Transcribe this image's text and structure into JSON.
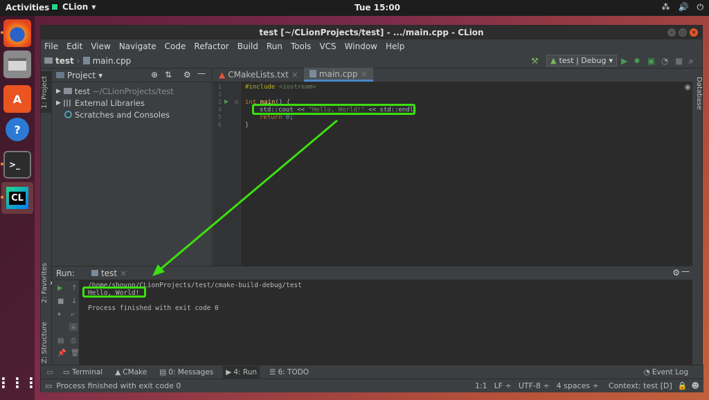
{
  "topbar": {
    "activities": "Activities",
    "app_name": "CLion",
    "clock": "Tue 15:00",
    "tray": [
      "⁂",
      "🔊",
      "⏻"
    ]
  },
  "window": {
    "title": "test [~/CLionProjects/test] - .../main.cpp - CLion"
  },
  "menu": [
    "File",
    "Edit",
    "View",
    "Navigate",
    "Code",
    "Refactor",
    "Build",
    "Run",
    "Tools",
    "VCS",
    "Window",
    "Help"
  ],
  "nav": {
    "crumb_project": "test",
    "crumb_file": "main.cpp",
    "run_config": "test | Debug"
  },
  "project": {
    "header": "Project",
    "items": [
      {
        "label": "test",
        "detail": "~/CLionProjects/test"
      },
      {
        "label": "External Libraries",
        "detail": ""
      },
      {
        "label": "Scratches and Consoles",
        "detail": ""
      }
    ]
  },
  "editor": {
    "tabs": [
      {
        "label": "CMakeLists.txt"
      },
      {
        "label": "main.cpp"
      }
    ],
    "line_numbers": [
      "1",
      "2",
      "3",
      "4",
      "5",
      "6"
    ],
    "lines": {
      "l1_directive": "#include",
      "l1_header": " <iostream>",
      "l3_kw": "int",
      "l3_fn": " main",
      "l3_rest": "() {",
      "l4_a": "std::cout << ",
      "l4_str": "\"Hello, World!\"",
      "l4_b": " << std::endl;",
      "l5_kw": "return",
      "l5_num": " 0",
      "l5_semi": ";",
      "l6": "}"
    }
  },
  "run": {
    "label": "Run:",
    "tab": "test",
    "output": [
      "/home/shovon/CLionProjects/test/cmake-build-debug/test",
      "Hello, World!",
      "",
      "Process finished with exit code 0"
    ]
  },
  "side_tabs": {
    "project": "1: Project",
    "favorites": "2: Favorites",
    "structure": "Z: Structure",
    "database": "Database"
  },
  "tool_tabs": [
    {
      "label": "Terminal"
    },
    {
      "label": "CMake"
    },
    {
      "label": "0: Messages"
    },
    {
      "label": "4: Run"
    },
    {
      "label": "6: TODO"
    }
  ],
  "event_log": "Event Log",
  "status": {
    "message": "Process finished with exit code 0",
    "position": "1:1",
    "line_sep": "LF ÷",
    "encoding": "UTF-8 ÷",
    "indent": "4 spaces ÷",
    "context": "Context: test [D]"
  },
  "colors": {
    "highlight": "#3ce00e",
    "accent": "#4a88c7"
  }
}
